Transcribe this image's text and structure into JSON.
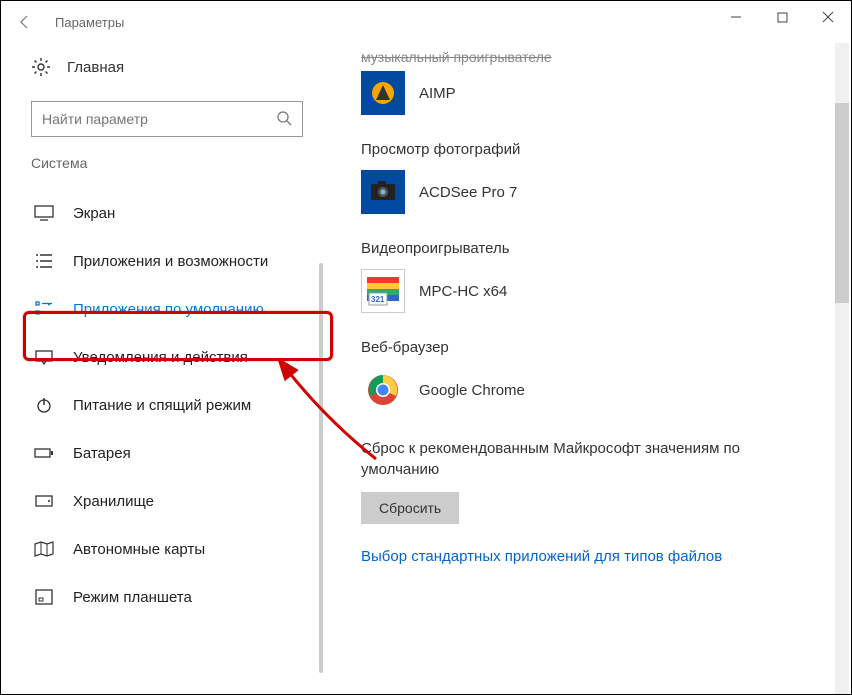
{
  "window": {
    "title": "Параметры"
  },
  "sidebar": {
    "home": "Главная",
    "search_placeholder": "Найти параметр",
    "category": "Система",
    "items": [
      {
        "label": "Экран"
      },
      {
        "label": "Приложения и возможности"
      },
      {
        "label": "Приложения по умолчанию",
        "active": true
      },
      {
        "label": "Уведомления и действия"
      },
      {
        "label": "Питание и спящий режим"
      },
      {
        "label": "Батарея"
      },
      {
        "label": "Хранилище"
      },
      {
        "label": "Автономные карты"
      },
      {
        "label": "Режим планшета"
      }
    ]
  },
  "main": {
    "truncated_section": "музыкальный проигрывателе",
    "sections": [
      {
        "title": "",
        "app": "AIMP"
      },
      {
        "title": "Просмотр фотографий",
        "app": "ACDSee Pro 7"
      },
      {
        "title": "Видеопроигрыватель",
        "app": "MPC-HC x64"
      },
      {
        "title": "Веб-браузер",
        "app": "Google Chrome"
      }
    ],
    "reset_text": "Сброс к рекомендованным Майкрософт значениям по умолчанию",
    "reset_button": "Сбросить",
    "link_filetypes": "Выбор стандартных приложений для типов файлов"
  }
}
